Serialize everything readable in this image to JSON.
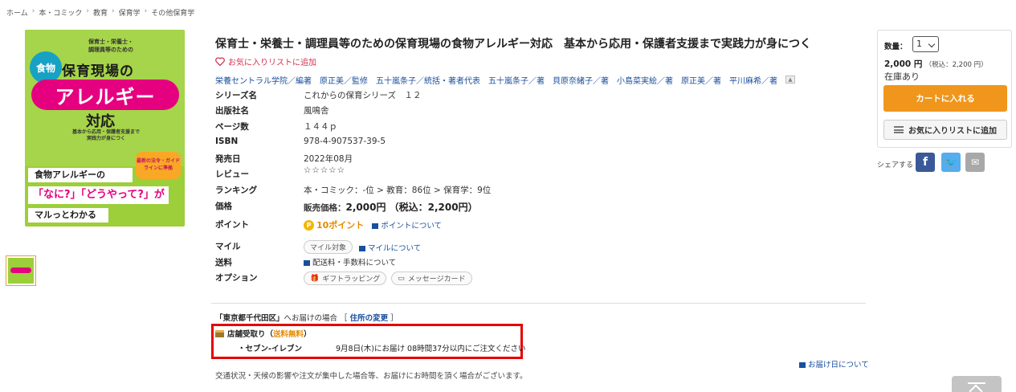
{
  "breadcrumb": [
    "ホーム",
    "本・コミック",
    "教育",
    "保育学",
    "その他保育学"
  ],
  "cover": {
    "line1": "保育士・栄養士・",
    "line1b": "調理員等のための",
    "title_main": "保育現場の",
    "food_badge": "食物",
    "allergy": "アレルギー",
    "taiou": "対応",
    "sub1": "基本から応用・保護者支援まで",
    "sub2": "実践力が身につく",
    "orange": "最新の法令・ガイドラインに準拠",
    "band1": "食物アレルギーの",
    "band2": "「なに?」「どうやって?」が",
    "band3": "マルっとわかる"
  },
  "product": {
    "title": "保育士・栄養士・調理員等のための保育現場の食物アレルギー対応　基本から応用・保護者支援まで実践力が身につく",
    "favorite": "お気に入りリストに追加",
    "authors": [
      "栄養セントラル学院／編著",
      "原正美／監修",
      "五十嵐条子／統括・著者代表",
      "五十嵐条子／著",
      "貝原奈緒子／著",
      "小島菜実絵／著",
      "原正美／著",
      "平川麻希／著"
    ]
  },
  "specs": {
    "series_label": "シリーズ名",
    "series": "これからの保育シリーズ　１２",
    "publisher_label": "出版社名",
    "publisher": "風鳴舎",
    "pages_label": "ページ数",
    "pages": "１４４ｐ",
    "isbn_label": "ISBN",
    "isbn": "978-4-907537-39-5",
    "date_label": "発売日",
    "date": "2022年08月",
    "review_label": "レビュー",
    "stars": "☆☆☆☆☆",
    "ranking_label": "ランキング",
    "ranking": "本・コミック：-位 > 教育：86位 > 保育学：9位",
    "price_label": "価格",
    "price_prefix": "販売価格：",
    "price": "2,000円 （税込：2,200円）",
    "point_label": "ポイント",
    "point": "10ポイント",
    "point_about": "ポイントについて",
    "mile_label": "マイル",
    "mile_chip": "マイル対象",
    "mile_about": "マイルについて",
    "ship_label": "送料",
    "ship_about": "配送料・手数料について",
    "option_label": "オプション",
    "opt_gift": "ギフトラッピング",
    "opt_msg": "メッセージカード"
  },
  "delivery": {
    "area": "「東京都千代田区」",
    "area_suffix": "へお届けの場合 ［",
    "change": "住所の変更",
    "close": "］",
    "store_pickup": "店舗受取り（",
    "free": "送料無料",
    "store_close": "）",
    "store_name": "・セブン-イレブン",
    "store_time": "9月8日(木)にお届け 08時間37分以内にご注文ください",
    "about": "お届け日について",
    "notice": "交通状況・天候の影響や注文が集中した場合等、お届けにお時間を頂く場合がございます。"
  },
  "cart": {
    "qty_label": "数量：",
    "qty_value": "1",
    "price": "2,000 円",
    "price_tax": "（税込：2,200 円）",
    "stock": "在庫あり",
    "cart_button": "カートに入れる",
    "wish_button": "お気に入りリストに追加",
    "share": "シェアする"
  },
  "colors": {
    "accent": "#f0961c",
    "link": "#1a4f9c",
    "highlight_box": "#e60000"
  }
}
